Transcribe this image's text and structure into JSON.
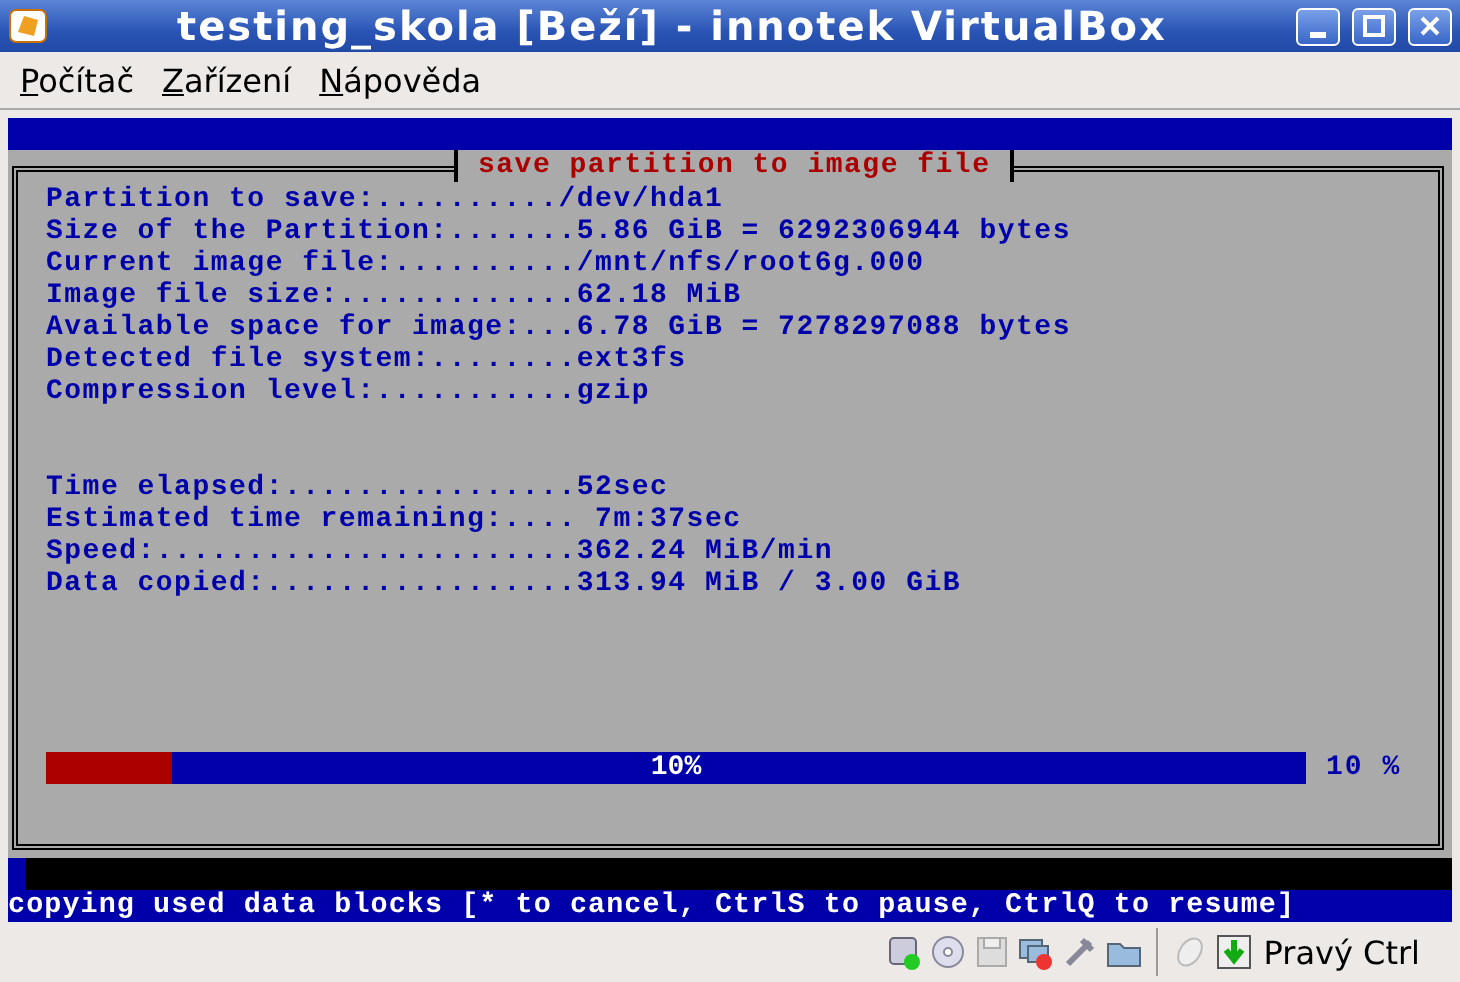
{
  "window": {
    "title": "testing_skola [Beží] - innotek VirtualBox"
  },
  "menu": [
    {
      "label": "Počítač"
    },
    {
      "label": "Zařízení"
    },
    {
      "label": "Nápověda"
    }
  ],
  "dialog": {
    "title": "save partition to image file",
    "info_lines": [
      "Partition to save:........../dev/hda1",
      "Size of the Partition:.......5.86 GiB = 6292306944 bytes",
      "Current image file:........../mnt/nfs/root6g.000",
      "Image file size:.............62.18 MiB",
      "Available space for image:...6.78 GiB = 7278297088 bytes",
      "Detected file system:........ext3fs",
      "Compression level:...........gzip"
    ],
    "progress_lines": [
      "Time elapsed:................52sec",
      "Estimated time remaining:.... 7m:37sec",
      "Speed:.......................362.24 MiB/min",
      "Data copied:.................313.94 MiB / 3.00 GiB"
    ],
    "progress": {
      "level": 0.1,
      "label": "10%",
      "reading": "10 %"
    }
  },
  "console_status": "copying used data blocks [* to cancel, CtrlS to pause, CtrlQ to resume]",
  "status_bar": {
    "host_key": "Pravý Ctrl"
  }
}
